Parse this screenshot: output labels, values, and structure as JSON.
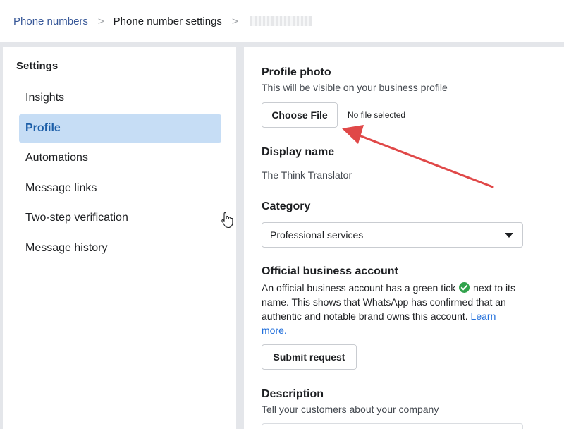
{
  "breadcrumb": {
    "items": [
      "Phone numbers",
      "Phone number settings"
    ],
    "separator": ">"
  },
  "sidebar": {
    "heading": "Settings",
    "items": [
      {
        "label": "Insights"
      },
      {
        "label": "Profile",
        "active": true
      },
      {
        "label": "Automations"
      },
      {
        "label": "Message links"
      },
      {
        "label": "Two-step verification"
      },
      {
        "label": "Message history"
      }
    ]
  },
  "profile_photo": {
    "title": "Profile photo",
    "subtitle": "This will be visible on your business profile",
    "button_label": "Choose File",
    "file_status": "No file selected"
  },
  "display_name": {
    "title": "Display name",
    "value": "The Think Translator"
  },
  "category": {
    "title": "Category",
    "selected": "Professional services"
  },
  "official_account": {
    "title": "Official business account",
    "text_before_tick": "An official business account has a green tick",
    "text_after_tick": " next to its name. This shows that WhatsApp has confirmed that an authentic and notable brand owns this account.",
    "link_label": "Learn more.",
    "button_label": "Submit request"
  },
  "description": {
    "title": "Description",
    "subtitle": "Tell your customers about your company"
  },
  "colors": {
    "active_nav_bg": "#c6ddf5",
    "active_nav_text": "#1c5ea8",
    "link": "#216fdb",
    "tick": "#31a24c",
    "annotation_arrow": "#e04848"
  }
}
